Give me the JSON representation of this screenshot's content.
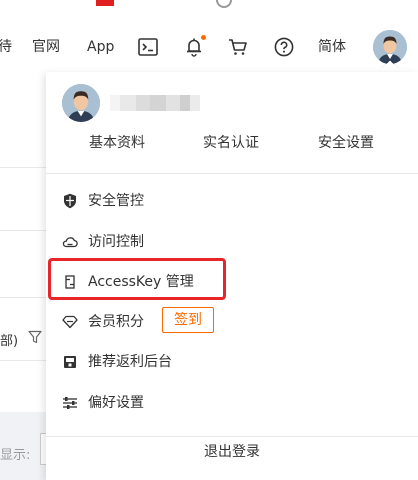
{
  "nav": {
    "partial_item": "待",
    "official_site": "官网",
    "app": "App",
    "language": "简体"
  },
  "background": {
    "partial_filter_text": "部)",
    "partial_hint_text": "显示:"
  },
  "dropdown": {
    "profile_links": [
      "基本资料",
      "实名认证",
      "安全设置"
    ],
    "menu": [
      {
        "label": "安全管控",
        "icon": "shield-icon"
      },
      {
        "label": "访问控制",
        "icon": "cloud-icon"
      },
      {
        "label": "AccessKey 管理",
        "icon": "key-icon"
      },
      {
        "label": "会员积分",
        "icon": "diamond-icon",
        "action": "签到"
      },
      {
        "label": "推荐返利后台",
        "icon": "gift-icon"
      },
      {
        "label": "偏好设置",
        "icon": "sliders-icon"
      }
    ],
    "logout": "退出登录"
  },
  "colors": {
    "accent": "#ff6a00",
    "highlight": "#e8262a"
  }
}
